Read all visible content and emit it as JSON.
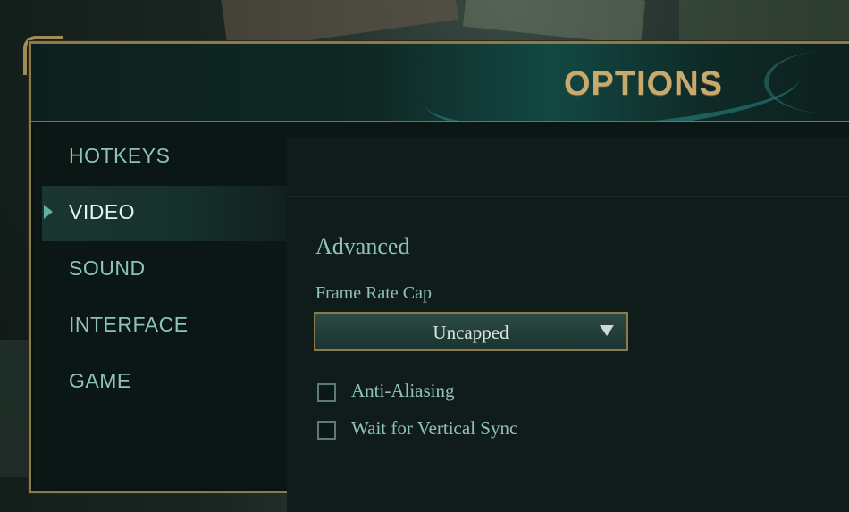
{
  "window": {
    "title": "OPTIONS"
  },
  "sidebar": {
    "items": [
      {
        "label": "HOTKEYS",
        "active": false
      },
      {
        "label": "VIDEO",
        "active": true
      },
      {
        "label": "SOUND",
        "active": false
      },
      {
        "label": "INTERFACE",
        "active": false
      },
      {
        "label": "GAME",
        "active": false
      }
    ]
  },
  "video": {
    "section_title": "Advanced",
    "frame_rate_cap": {
      "label": "Frame Rate Cap",
      "value": "Uncapped"
    },
    "anti_aliasing": {
      "label": "Anti-Aliasing",
      "checked": false
    },
    "vertical_sync": {
      "label": "Wait for Vertical Sync",
      "checked": false
    }
  },
  "colors": {
    "gold_border": "#8a7a4c",
    "title_gold": "#c8aa6e",
    "teal_text": "#8fc3b8",
    "active_text": "#e6f2ee",
    "panel_bg": "#101c1a"
  }
}
